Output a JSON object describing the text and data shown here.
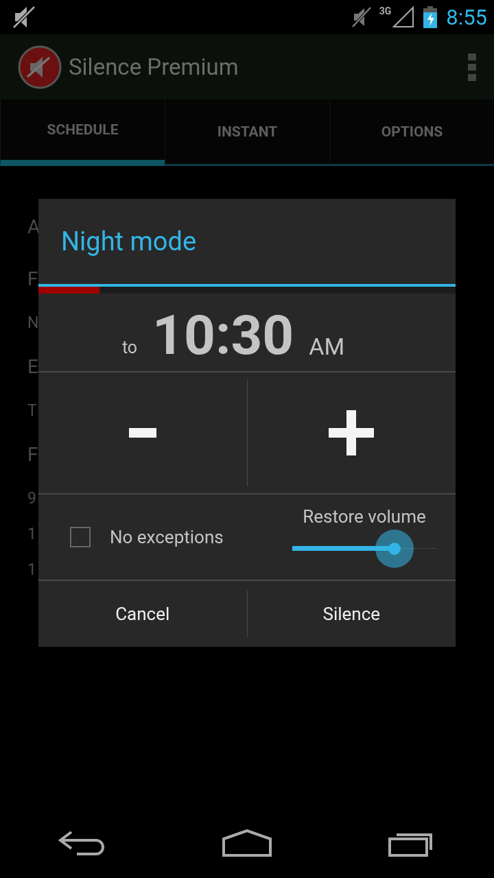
{
  "status_bar": {
    "time": "8:55",
    "network": "3G"
  },
  "app_bar": {
    "title": "Silence Premium"
  },
  "tabs": [
    {
      "label": "SCHEDULE",
      "selected": true
    },
    {
      "label": "INSTANT",
      "selected": false
    },
    {
      "label": "OPTIONS",
      "selected": false
    }
  ],
  "background_rows": [
    {
      "text": "A",
      "kind": "title"
    },
    {
      "text": "F",
      "kind": "title"
    },
    {
      "text": "N",
      "kind": "sub"
    },
    {
      "text": "E",
      "kind": "title"
    },
    {
      "text": "T",
      "kind": "sub"
    },
    {
      "text": "F",
      "kind": "title"
    },
    {
      "text": "9",
      "kind": "sub"
    },
    {
      "text": "1",
      "kind": "sub"
    },
    {
      "text": "1",
      "kind": "sub"
    }
  ],
  "dialog": {
    "title": "Night mode",
    "progress": {
      "level": 0.146
    },
    "time": {
      "prefix": "to",
      "value": "10:30",
      "suffix": "AM"
    },
    "option": {
      "label": "No exceptions",
      "checked": false
    },
    "slider": {
      "label": "Restore volume",
      "level": 0.71
    },
    "buttons": [
      "Cancel",
      "Silence"
    ]
  }
}
